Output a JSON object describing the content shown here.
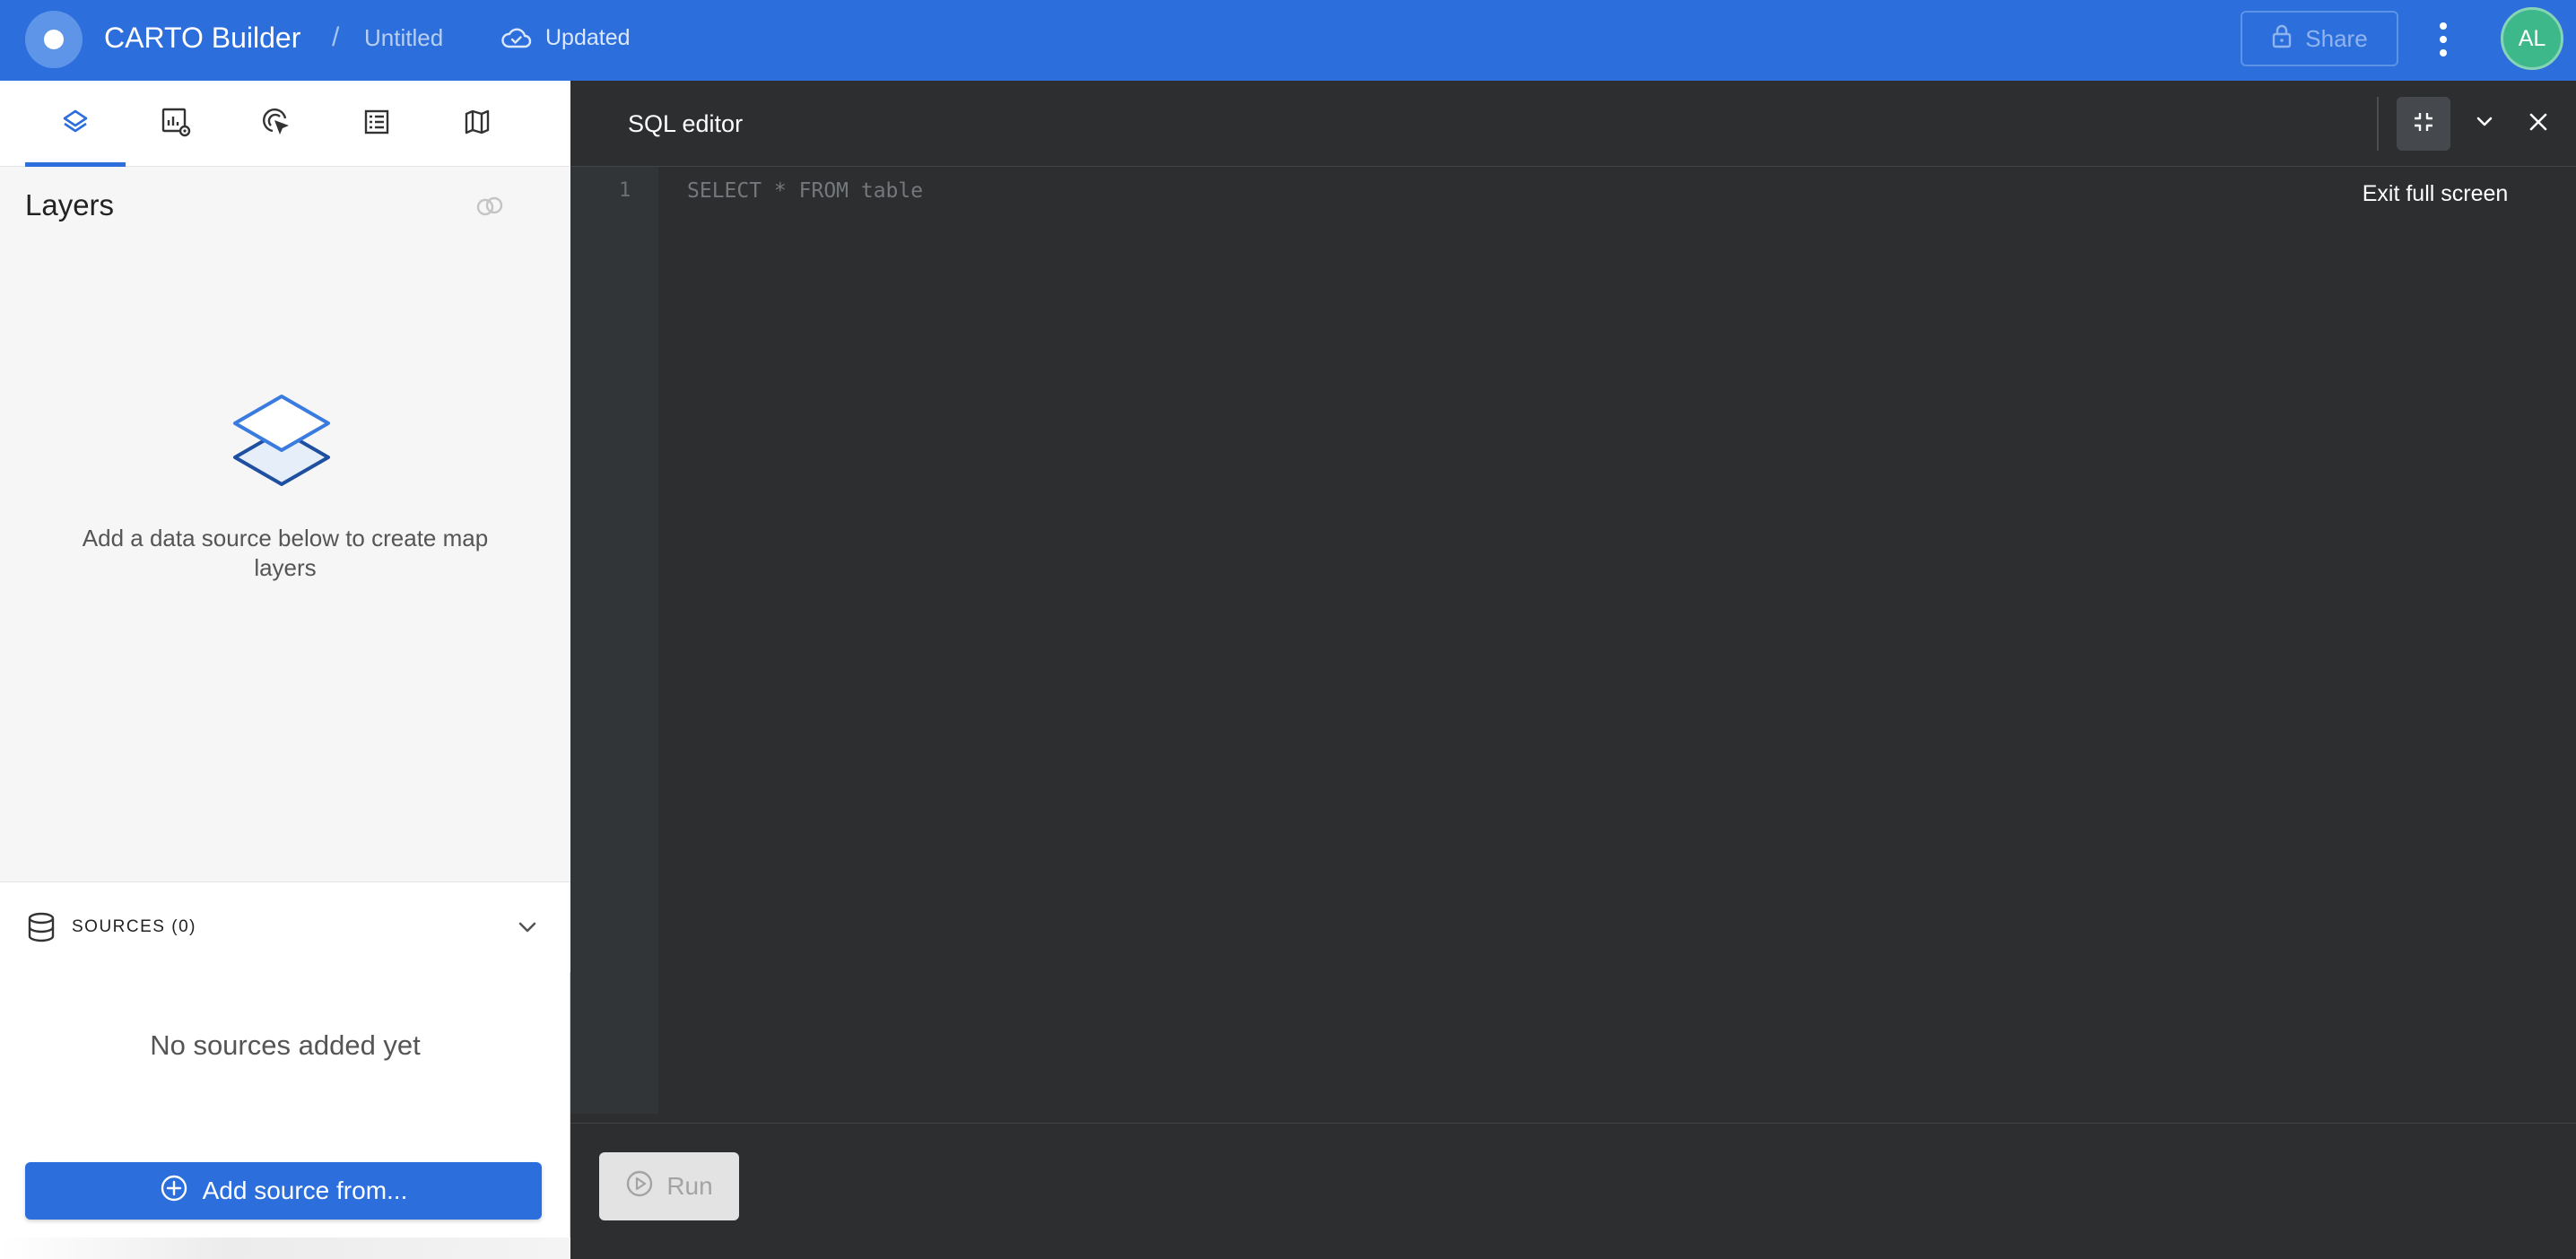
{
  "topbar": {
    "app_title": "CARTO Builder",
    "separator": "/",
    "map_name": "Untitled",
    "save_status": "Updated",
    "share_label": "Share",
    "avatar_initials": "AL",
    "colors": {
      "bar": "#2c6fdc",
      "avatar": "#3db88a"
    }
  },
  "sidebar": {
    "tabs": [
      {
        "name": "layers",
        "icon": "layers-icon",
        "active": true
      },
      {
        "name": "widgets",
        "icon": "widgets-icon",
        "active": false
      },
      {
        "name": "interactions",
        "icon": "interactions-icon",
        "active": false
      },
      {
        "name": "legend",
        "icon": "legend-icon",
        "active": false
      },
      {
        "name": "basemaps",
        "icon": "basemap-icon",
        "active": false
      }
    ],
    "layers_title": "Layers",
    "empty_message": "Add a data source below to create map layers",
    "sources_label": "SOURCES (0)",
    "no_sources": "No sources added yet",
    "add_source_label": "Add source from..."
  },
  "sql_editor": {
    "title": "SQL editor",
    "tooltip": "Exit full screen",
    "line_number": "1",
    "placeholder_code": "SELECT * FROM table",
    "run_label": "Run",
    "colors": {
      "background": "#2c2e30",
      "gutter": "#323538"
    }
  }
}
